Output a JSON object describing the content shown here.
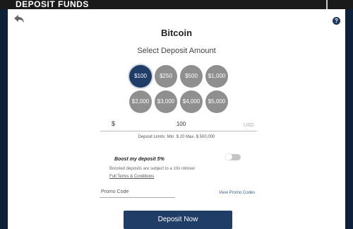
{
  "header": {
    "title": "DEPOSIT FUNDS"
  },
  "nav": {
    "back_icon": "back-arrow-icon",
    "help_label": "?"
  },
  "main": {
    "title": "Bitcoin",
    "subtitle": "Select Deposit Amount",
    "amounts": [
      "$100",
      "$250",
      "$500",
      "$1,000",
      "$2,000",
      "$3,000",
      "$4,000",
      "$5,000"
    ],
    "selected_amount": "$100",
    "currency_symbol": "$",
    "amount_value": "100",
    "currency_code": "USD",
    "limits_text": "Deposit Limits: Min. $ 20   Max. $ 500,000"
  },
  "boost": {
    "label": "Boost my deposit 5%",
    "description": "Boosted deposits are subject to a 10x rollover",
    "terms_link": "Full Terms & Conditions",
    "enabled": false
  },
  "promo": {
    "placeholder": "Promo Code",
    "value": "",
    "view_link": "View Promo Codes"
  },
  "actions": {
    "deposit_label": "Deposit Now"
  },
  "colors": {
    "accent": "#1f3d66",
    "unselected": "#8f8f8f",
    "topbar": "#1a1a1a"
  }
}
